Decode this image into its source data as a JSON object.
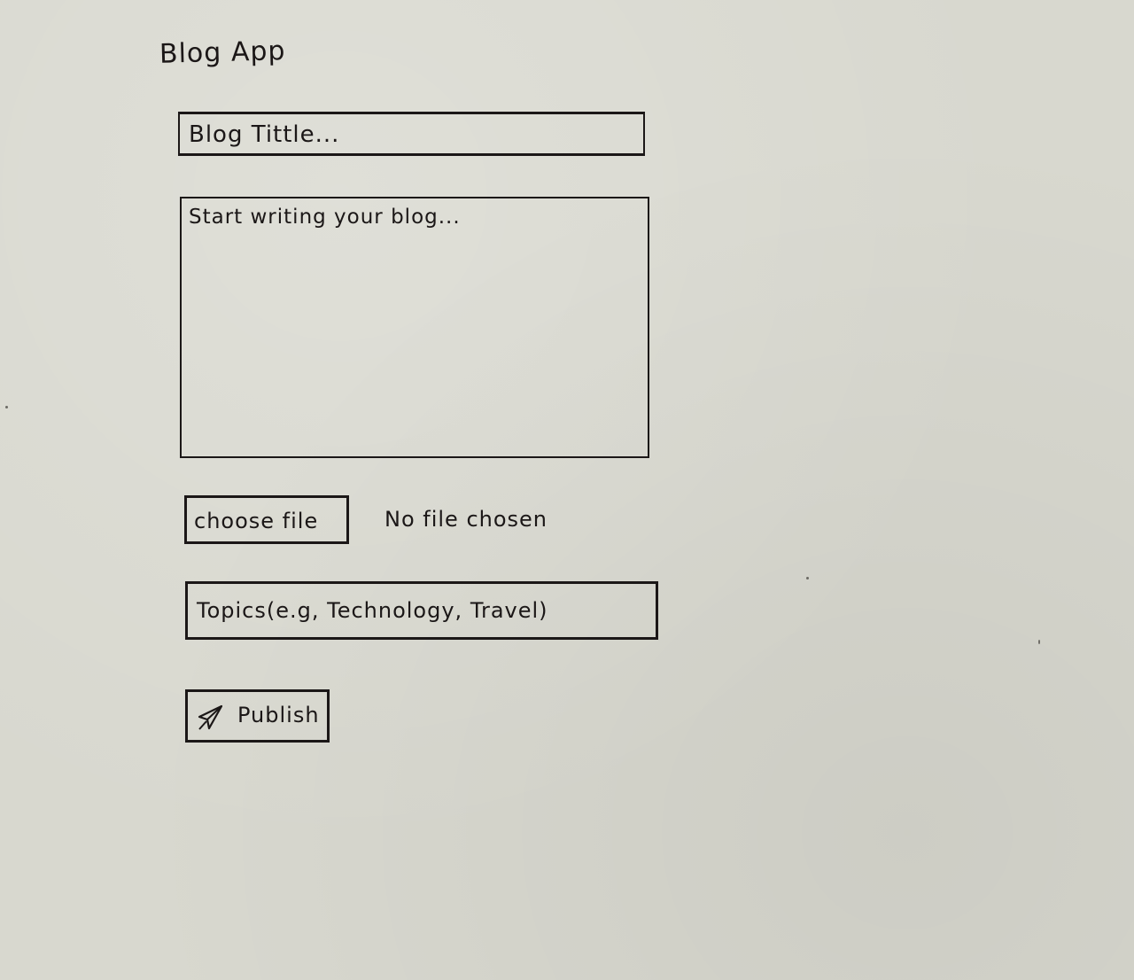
{
  "app": {
    "title": "Blog App"
  },
  "form": {
    "title_placeholder": "Blog Tittle...",
    "body_placeholder": "Start writing your blog...",
    "choose_file_label": "choose file",
    "file_status": "No file chosen",
    "topics_placeholder": "Topics(e.g, Technology, Travel)",
    "publish_label": "Publish"
  },
  "icons": {
    "publish": "send-icon"
  },
  "colors": {
    "paper": "#d8d8cf",
    "ink": "#1b1717"
  }
}
